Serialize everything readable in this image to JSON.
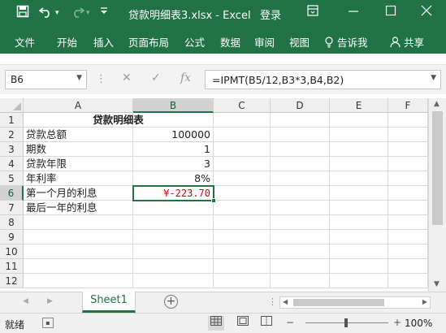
{
  "titlebar": {
    "save_icon": "save-icon",
    "undo_icon": "undo-icon",
    "redo_icon": "redo-icon",
    "customize_icon": "customize-qat-icon",
    "title": "贷款明细表3.xlsx - Excel",
    "login": "登录",
    "ribbon_display_icon": "ribbon-display-options-icon",
    "minimize_icon": "minimize-icon",
    "maximize_icon": "maximize-icon",
    "close_icon": "close-icon"
  },
  "ribbon": {
    "tabs": [
      "文件",
      "开始",
      "插入",
      "页面布局",
      "公式",
      "数据",
      "审阅",
      "视图"
    ],
    "tell_me": "告诉我",
    "share": "共享"
  },
  "formula_bar": {
    "name_box": "B6",
    "fx_label": "fx",
    "formula": "=IPMT(B5/12,B3*3,B4,B2)"
  },
  "grid": {
    "columns": [
      "A",
      "B",
      "C",
      "D",
      "E",
      "F"
    ],
    "selected_column": "B",
    "rows": [
      "1",
      "2",
      "3",
      "4",
      "5",
      "6",
      "7",
      "8",
      "9",
      "10",
      "11",
      "12"
    ],
    "selected_row": "6",
    "cells": {
      "A1": "贷款明细表",
      "A2": "贷款总额",
      "B2": "100000",
      "A3": "期数",
      "B3": "1",
      "A4": "贷款年限",
      "B4": "3",
      "A5": "年利率",
      "B5": "8%",
      "A6": "第一个月的利息",
      "B6": "¥-223.70",
      "A7": "最后一年的利息"
    }
  },
  "sheets": {
    "active": "Sheet1"
  },
  "status": {
    "ready": "就绪",
    "zoom": "100%"
  },
  "colors": {
    "accent": "#217346",
    "negative": "#dd0000"
  }
}
